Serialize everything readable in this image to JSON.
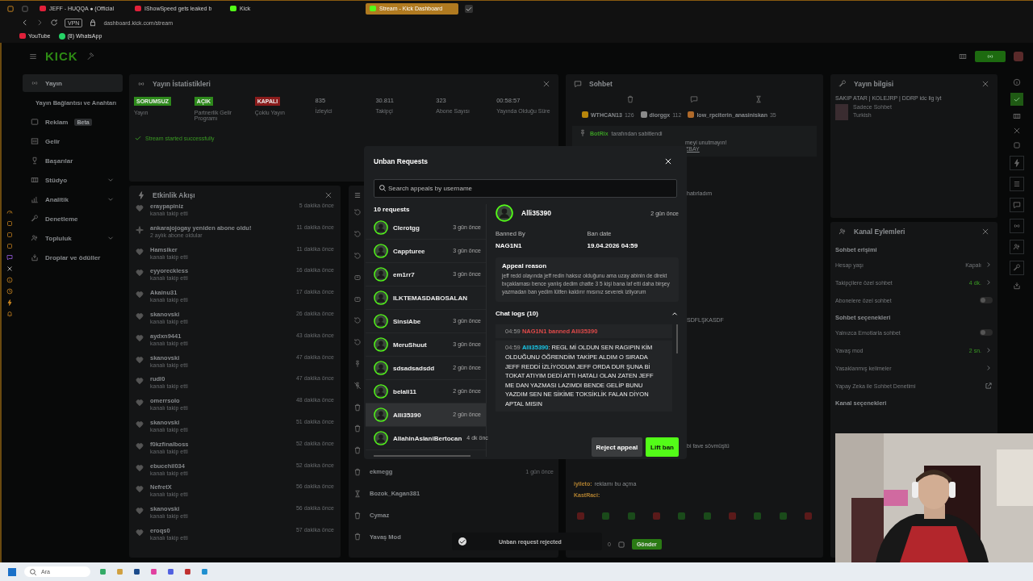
{
  "browser": {
    "tabs": [
      {
        "title": "JEFF - HUQQA ● (Official",
        "selected": false
      },
      {
        "title": "IShowSpeed gets leaked b",
        "selected": false
      },
      {
        "title": "Kick",
        "selected": false
      },
      {
        "title": "Stream - Kick Dashboard",
        "selected": true
      }
    ],
    "vpn": "VPN",
    "address": "dashboard.kick.com/stream",
    "bookmarks": [
      {
        "label": "YouTube"
      },
      {
        "label": "(8) WhatsApp"
      }
    ]
  },
  "dashboard": {
    "logo": "KICK",
    "sidebar": [
      {
        "label": "Yayın",
        "selected": true,
        "expandable": false
      },
      {
        "label": "Yayın Bağlantısı ve Anahtarı",
        "selected": false,
        "expandable": false
      },
      {
        "label": "Reklam",
        "badge": "Beta",
        "selected": false,
        "expandable": false
      },
      {
        "label": "Gelir",
        "selected": false,
        "expandable": false
      },
      {
        "label": "Başarılar",
        "selected": false,
        "expandable": false
      },
      {
        "label": "Stüdyo",
        "selected": false,
        "expandable": true
      },
      {
        "label": "Analitik",
        "selected": false,
        "expandable": true
      },
      {
        "label": "Denetleme",
        "selected": false,
        "expandable": false
      },
      {
        "label": "Topluluk",
        "selected": false,
        "expandable": true
      },
      {
        "label": "Droplar ve ödüller",
        "selected": false,
        "expandable": false
      }
    ],
    "stats": {
      "title": "Yayın İstatistikleri",
      "items": [
        {
          "kind": "badge",
          "value": "SORUMSUZ",
          "label": "Yayın",
          "color": "#2e8a1c"
        },
        {
          "kind": "badge",
          "value": "AÇIK",
          "label": "Partnerlik Gelir Programı",
          "color": "#2e8a1c"
        },
        {
          "kind": "badge",
          "value": "KAPALI",
          "label": "Çoklu Yayın",
          "color": "#8a1c1c"
        },
        {
          "kind": "number",
          "value": "835",
          "label": "İzleyici"
        },
        {
          "kind": "number",
          "value": "30.811",
          "label": "Takipçi"
        },
        {
          "kind": "number",
          "value": "323",
          "label": "Abone Sayısı"
        },
        {
          "kind": "number",
          "value": "00:58:57",
          "label": "Yayında Olduğu Süre"
        }
      ],
      "status": "Stream started successfully"
    },
    "activity": {
      "title": "Etkinlik Akışı",
      "items": [
        {
          "kind": "follow",
          "name": "eraypapiniz",
          "sub": "kanalı takip etti",
          "time": "5 dakika önce"
        },
        {
          "kind": "resub",
          "name": "ankarajojogay yeniden abone oldu!",
          "sub": "2 aylık abone oldular",
          "time": "11 dakika önce"
        },
        {
          "kind": "follow",
          "name": "Hamsiker",
          "sub": "kanalı takip etti",
          "time": "11 dakika önce"
        },
        {
          "kind": "follow",
          "name": "eyyoreckless",
          "sub": "kanalı takip etti",
          "time": "16 dakika önce"
        },
        {
          "kind": "follow",
          "name": "Akainu31",
          "sub": "kanalı takip etti",
          "time": "17 dakika önce"
        },
        {
          "kind": "follow",
          "name": "skanovski",
          "sub": "kanalı takip etti",
          "time": "26 dakika önce"
        },
        {
          "kind": "follow",
          "name": "aydxn9441",
          "sub": "kanalı takip etti",
          "time": "43 dakika önce"
        },
        {
          "kind": "follow",
          "name": "skanovski",
          "sub": "kanalı takip etti",
          "time": "47 dakika önce"
        },
        {
          "kind": "follow",
          "name": "rudl0",
          "sub": "kanalı takip etti",
          "time": "47 dakika önce"
        },
        {
          "kind": "follow",
          "name": "omerrsolo",
          "sub": "kanalı takip etti",
          "time": "48 dakika önce"
        },
        {
          "kind": "follow",
          "name": "skanovski",
          "sub": "kanalı takip etti",
          "time": "51 dakika önce"
        },
        {
          "kind": "follow",
          "name": "f0kzfinalboss",
          "sub": "kanalı takip etti",
          "time": "52 dakika önce"
        },
        {
          "kind": "follow",
          "name": "ebucehil034",
          "sub": "kanalı takip etti",
          "time": "52 dakika önce"
        },
        {
          "kind": "follow",
          "name": "NefretX",
          "sub": "kanalı takip etti",
          "time": "56 dakika önce"
        },
        {
          "kind": "follow",
          "name": "skanovski",
          "sub": "kanalı takip etti",
          "time": "56 dakika önce"
        },
        {
          "kind": "follow",
          "name": "eroqs0",
          "sub": "kanalı takip etti",
          "time": "57 dakika önce"
        }
      ]
    },
    "modlog": {
      "items": [
        {
          "kind": "unban"
        },
        {
          "kind": "unban"
        },
        {
          "kind": "unban"
        },
        {
          "kind": "timeout"
        },
        {
          "kind": "timeout"
        },
        {
          "kind": "unban"
        },
        {
          "kind": "unban"
        },
        {
          "kind": "pin"
        },
        {
          "kind": "unpin"
        },
        {
          "kind": "delete"
        },
        {
          "kind": "delete"
        },
        {
          "kind": "delete"
        },
        {
          "kind": "delete",
          "name": "ekmegg",
          "time": "1 gün önce"
        },
        {
          "kind": "slow",
          "name": "Bozok_Kagan381"
        },
        {
          "kind": "delete",
          "name": "Cymaz"
        },
        {
          "kind": "delete",
          "name": "Yavaş Mod"
        }
      ]
    },
    "chat": {
      "title": "Sohbet",
      "leaders": [
        {
          "name": "WTHCAN13",
          "count": "126",
          "color": "#b8860b"
        },
        {
          "name": "diorggx",
          "count": "112",
          "color": "#8a8a8a"
        },
        {
          "name": "low_rpciterin_anasiniskan",
          "count": "35",
          "color": "#b06a2a"
        }
      ],
      "pinned": {
        "by": "BotRix",
        "note": "tarafından sabitlendi",
        "lines": [
          {
            "text": "meyi unutmayın!",
            "link": false
          },
          {
            "text": "ZBAY",
            "link": true
          }
        ]
      },
      "lines": [
        {
          "text": "hatırladım"
        },
        {
          "text": "SDFLŞKASDF"
        },
        {
          "text": "bi fave sövmüştü"
        }
      ],
      "messages": [
        {
          "user": "iyileto:",
          "text": "reklamı bu açma"
        },
        {
          "user": "KastRaci:"
        }
      ],
      "count": "0",
      "send": "Gönder"
    },
    "stream_info": {
      "title": "Yayın bilgisi",
      "stream_title": "SAKIP ATAR | KOLEJRP | DDRP idc lig iyt",
      "category": "Sadece Sohbet",
      "language": "Turkish"
    },
    "channel_actions": {
      "title": "Kanal Eylemleri",
      "rows": [
        {
          "kind": "section",
          "label": "Sohbet erişimi"
        },
        {
          "kind": "link",
          "label": "Hesap yaşı",
          "value": "Kapalı",
          "on": false
        },
        {
          "kind": "link",
          "label": "Takipçilere özel sohbet",
          "value": "4 dk.",
          "on": true
        },
        {
          "kind": "toggle",
          "label": "Abonelere özel sohbet",
          "on": false
        },
        {
          "kind": "section",
          "label": "Sohbet seçenekleri"
        },
        {
          "kind": "toggle",
          "label": "Yalnızca Emotlarla sohbet",
          "on": false
        },
        {
          "kind": "link",
          "label": "Yavaş mod",
          "value": "2 sn.",
          "on": true
        },
        {
          "kind": "link",
          "label": "Yasaklanmış kelimeler"
        },
        {
          "kind": "external",
          "label": "Yapay Zeka ile Sohbet Denetimi"
        },
        {
          "kind": "section",
          "label": "Kanal seçenekleri"
        }
      ]
    }
  },
  "modal": {
    "title": "Unban Requests",
    "search": {
      "placeholder": "Search appeals by username"
    },
    "count": "10 requests",
    "requests": [
      {
        "name": "Clerotgg",
        "time": "3 gün önce",
        "selected": false
      },
      {
        "name": "Cappturee",
        "time": "3 gün önce",
        "selected": false
      },
      {
        "name": "em1rr7",
        "time": "3 gün önce",
        "selected": false
      },
      {
        "name": "ILKTEMASDABOSALAN",
        "selected": false
      },
      {
        "name": "SinsiAbe",
        "time": "3 gün önce",
        "selected": false
      },
      {
        "name": "MeruShuut",
        "time": "3 gün önce",
        "selected": false
      },
      {
        "name": "sdsadsadsdd",
        "time": "2 gün önce",
        "selected": false
      },
      {
        "name": "belali11",
        "time": "2 gün önce",
        "selected": false
      },
      {
        "name": "Alli35390",
        "time": "2 gün önce",
        "selected": true
      },
      {
        "name": "AllahinAslaniBertocan",
        "time": "4 dk önc",
        "selected": false
      }
    ],
    "detail": {
      "name": "Alli35390",
      "time": "2 gün önce",
      "fields": [
        {
          "label": "Banned By",
          "value": "NAG1N1"
        },
        {
          "label": "Ban date",
          "value": "19.04.2026 04:59"
        }
      ],
      "appeal_title": "Appeal reason",
      "appeal_text": "jeff redd olayında jeff redin haksız olduğunu ama uzay abinin de direkt bıçaklaması bence yanlış dedim chatte 3 5 kişi bana laf etti daha birşey yazmadan ban yedim lütfen kaldırır mısınız severek izliyorum",
      "logs_title": "Chat logs (10)",
      "logs_expanded": true,
      "logs": [
        {
          "kind": "system",
          "time": "04:59",
          "text": "NAG1N1 banned Alli35390"
        },
        {
          "kind": "message",
          "time": "04:59",
          "user": "Alli35390",
          "text": ": REGL Mİ OLDUN SEN RAGIPIN KİM OLDUĞUNU ÖĞRENDİM TAKİPE ALDIM O SIRADA JEFF REDDİ İZLİYODUM JEFF ORDA DUR ŞUNA Bİ TOKAT ATIYIM DEDİ ATTI HATALI OLAN ZATEN JEFF ME DAN YAZMASI LAZIMDI BENDE GELİP BUNU YAZDIM SEN NE SİKİME TOKSİKLİK FALAN DİYON APTAL MISIN"
        }
      ],
      "buttons": [
        {
          "label": "Reject appeal",
          "kind": "secondary"
        },
        {
          "label": "Lift ban",
          "kind": "primary"
        }
      ]
    }
  },
  "toast": {
    "text": "Unban request rejected"
  },
  "taskbar": {
    "search": "Ara"
  }
}
